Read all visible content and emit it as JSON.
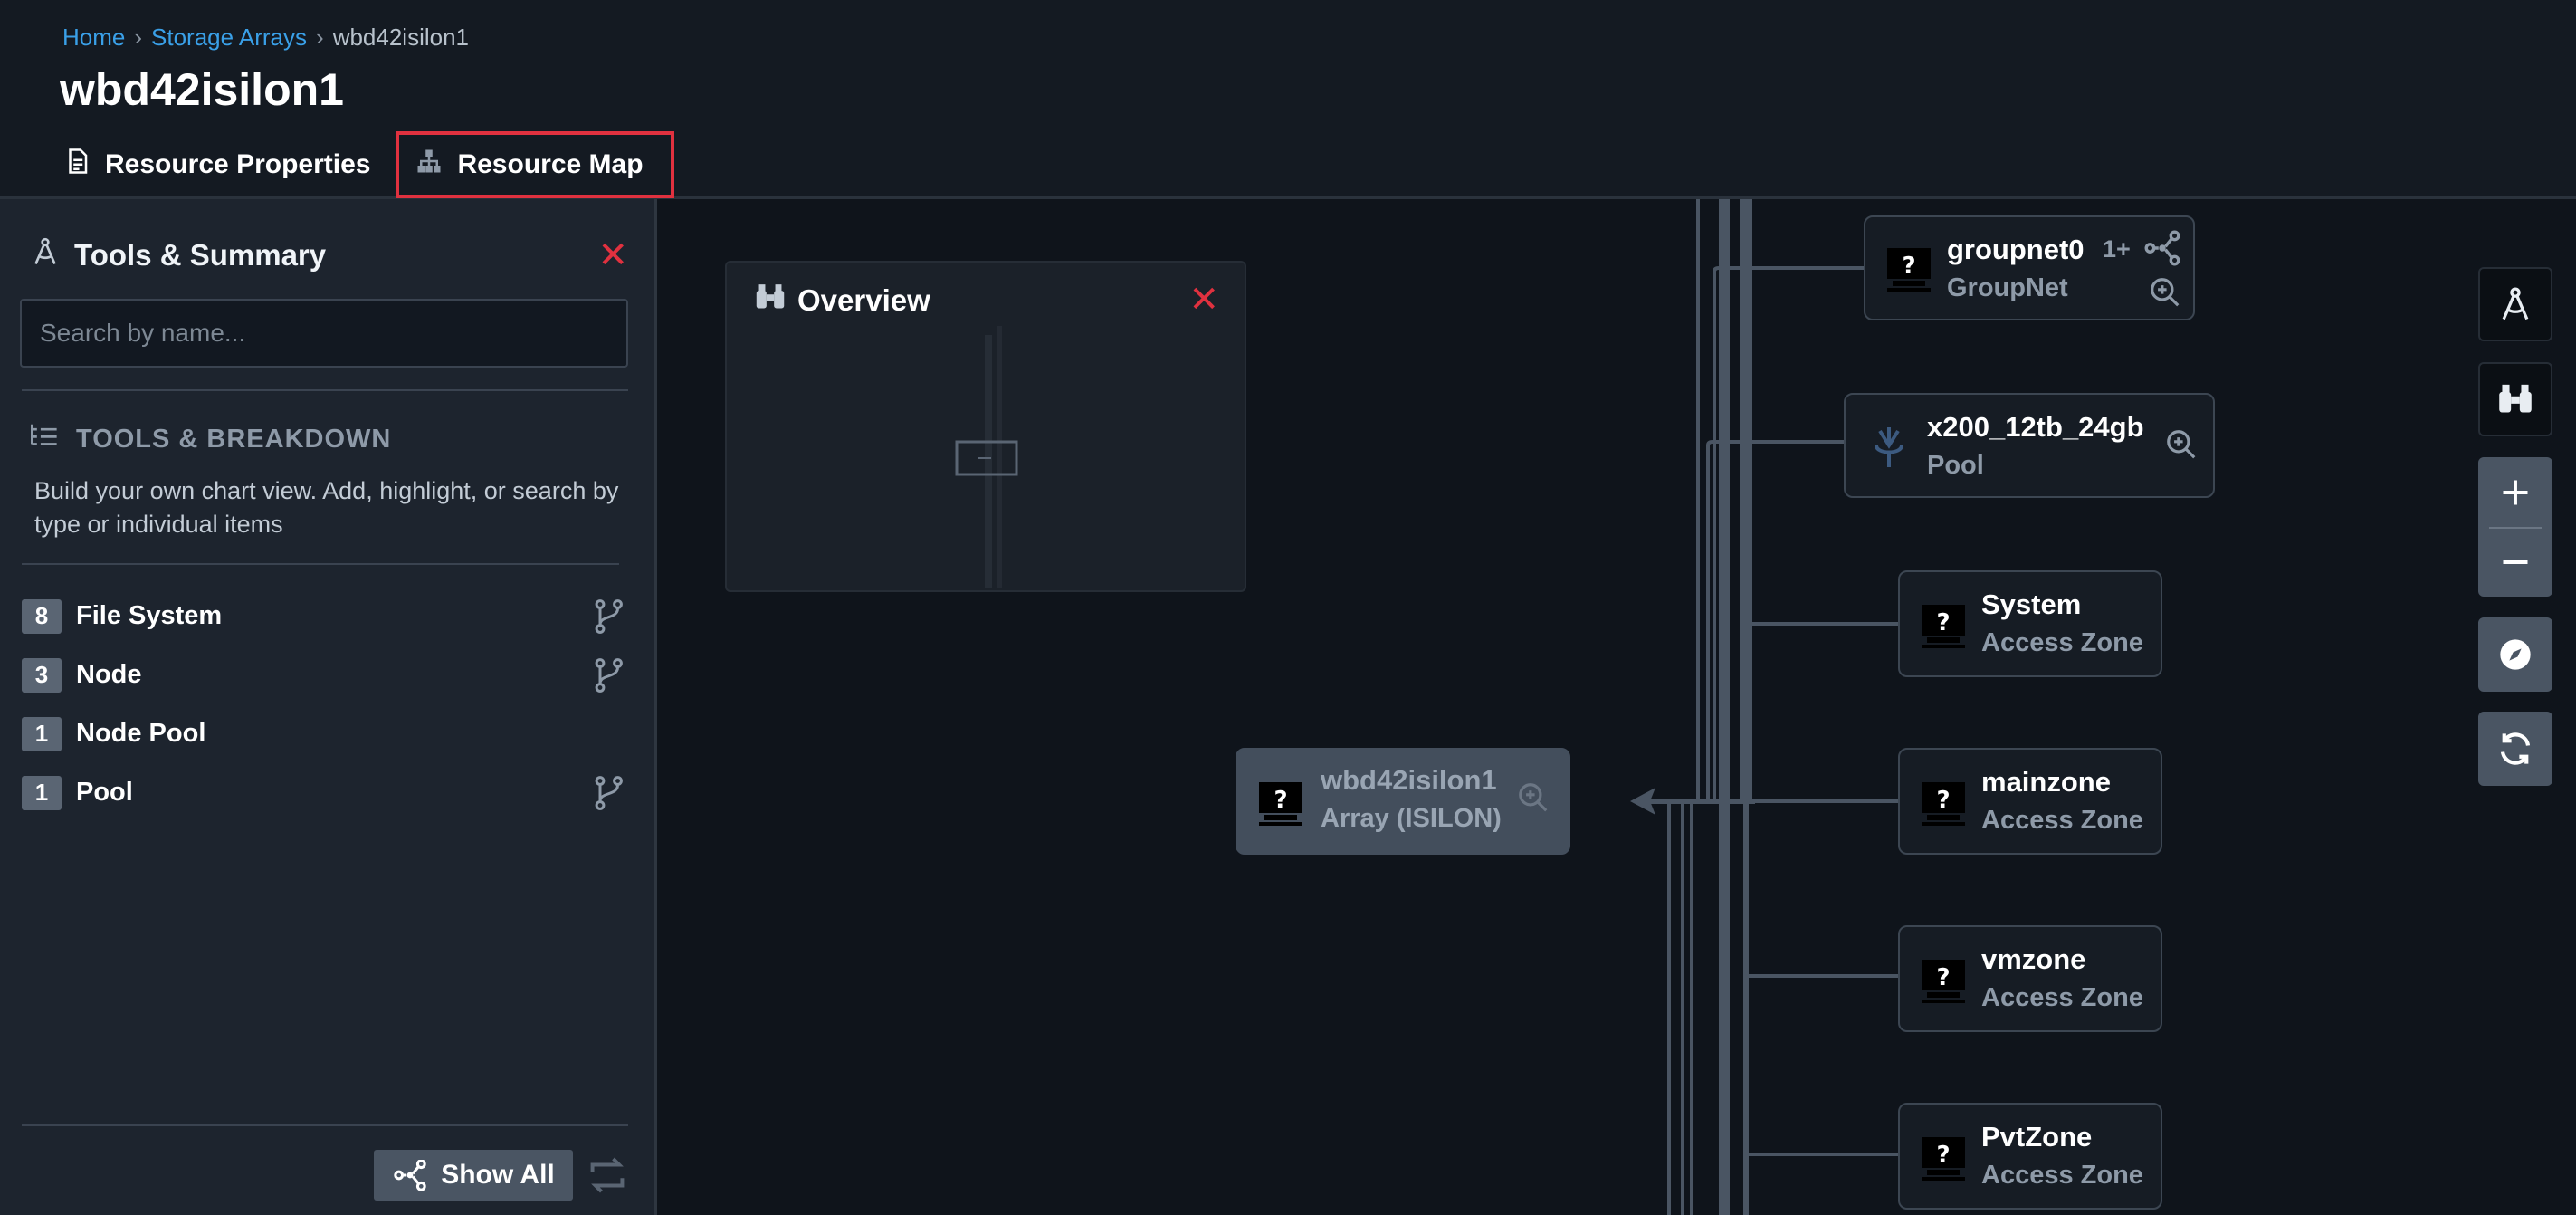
{
  "breadcrumb": {
    "home": "Home",
    "sep1": "›",
    "storage_arrays": "Storage Arrays",
    "sep2": "›",
    "current": "wbd42isilon1"
  },
  "page_title": "wbd42isilon1",
  "tabs": [
    {
      "label": "Resource Properties",
      "icon": "document-icon",
      "active": false
    },
    {
      "label": "Resource Map",
      "icon": "hierarchy-icon",
      "active": true
    }
  ],
  "panel": {
    "title": "Tools & Summary",
    "close": "✕",
    "search_placeholder": "Search by name...",
    "section_title": "TOOLS & BREAKDOWN",
    "section_desc": "Build your own chart view. Add, highlight, or search by type or individual items",
    "items": [
      {
        "count": "8",
        "label": "File System",
        "has_branch": true
      },
      {
        "count": "3",
        "label": "Node",
        "has_branch": true
      },
      {
        "count": "1",
        "label": "Node Pool",
        "has_branch": false
      },
      {
        "count": "1",
        "label": "Pool",
        "has_branch": true
      }
    ],
    "show_all": "Show All"
  },
  "overview": {
    "title": "Overview",
    "close": "✕"
  },
  "nodes": {
    "root": {
      "name": "wbd42isilon1",
      "type": "Array (ISILON)"
    },
    "groupnet": {
      "name": "groupnet0",
      "type": "GroupNet",
      "badge": "1+"
    },
    "pool": {
      "name": "x200_12tb_24gb",
      "type": "Pool"
    },
    "system": {
      "name": "System",
      "type": "Access Zone"
    },
    "mainzone": {
      "name": "mainzone",
      "type": "Access Zone"
    },
    "vmzone": {
      "name": "vmzone",
      "type": "Access Zone"
    },
    "pvtzone": {
      "name": "PvtZone",
      "type": "Access Zone"
    }
  },
  "colors": {
    "accent": "#3aa0e8",
    "active_border": "#e0313f",
    "panel_bg": "#1d242e",
    "canvas_bg": "#0f141b"
  }
}
